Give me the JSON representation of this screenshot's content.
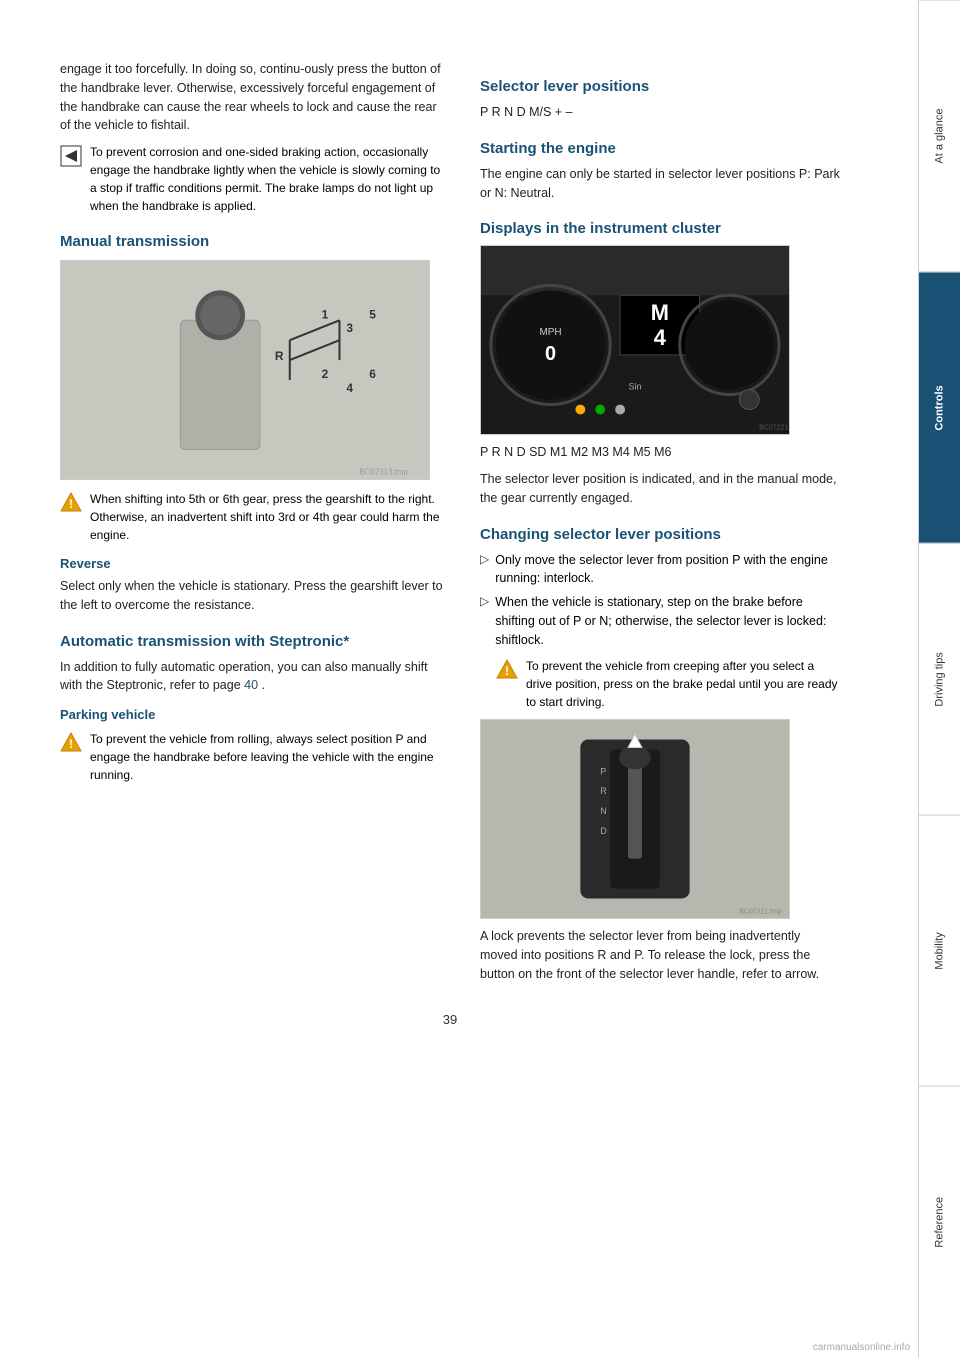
{
  "page": {
    "number": "39"
  },
  "sidebar": {
    "sections": [
      {
        "label": "At a glance",
        "active": false
      },
      {
        "label": "Controls",
        "active": true
      },
      {
        "label": "Driving tips",
        "active": false
      },
      {
        "label": "Mobility",
        "active": false
      },
      {
        "label": "Reference",
        "active": false
      }
    ]
  },
  "left_col": {
    "intro_para": "engage it too forcefully. In doing so, continu-ously press the button of the handbrake lever. Otherwise, excessively forceful engagement of the handbrake can cause the rear wheels to lock and cause the rear of the vehicle to fishtail.",
    "note1": "To prevent corrosion and one-sided braking action, occasionally engage the handbrake lightly when the vehicle is slowly coming to a stop if traffic conditions permit. The brake lamps do not light up when the handbrake is applied.",
    "manual_transmission_heading": "Manual transmission",
    "manual_note": "When shifting into 5th or 6th gear, press the gearshift to the right. Otherwise, an inadvertent shift into 3rd or 4th gear could harm the engine.",
    "reverse_heading": "Reverse",
    "reverse_text": "Select only when the vehicle is stationary. Press the gearshift lever to the left to overcome the resistance.",
    "auto_heading": "Automatic transmission with Steptronic*",
    "auto_text1": "In addition to fully automatic operation, you can also manually shift with the Steptronic, refer to page",
    "auto_link": "40",
    "auto_text2": ".",
    "parking_heading": "Parking vehicle",
    "parking_note": "To prevent the vehicle from rolling, always select position P and engage the handbrake before leaving the vehicle with the engine running."
  },
  "right_col": {
    "selector_heading": "Selector lever positions",
    "selector_positions": "P R N D M/S + –",
    "starting_heading": "Starting the engine",
    "starting_text": "The engine can only be started in selector lever positions P: Park or N: Neutral.",
    "display_heading": "Displays in the instrument cluster",
    "display_positions": "P R N D SD M1 M2 M3 M4 M5 M6",
    "display_text": "The selector lever position is indicated, and in the manual mode, the gear currently engaged.",
    "changing_heading": "Changing selector lever positions",
    "bullet1": "Only move the selector lever from position P with the engine running: interlock.",
    "bullet2": "When the vehicle is stationary, step on the brake before shifting out of P or N; otherwise, the selector lever is locked: shiftlock.",
    "changing_note": "To prevent the vehicle from creeping after you select a drive position, press on the brake pedal until you are ready to start driving.",
    "lock_text": "A lock prevents the selector lever from being inadvertently moved into positions R and P. To release the lock, press the button on the front of the selector lever handle, refer to arrow."
  },
  "watermark": "carmanualsonline.info"
}
